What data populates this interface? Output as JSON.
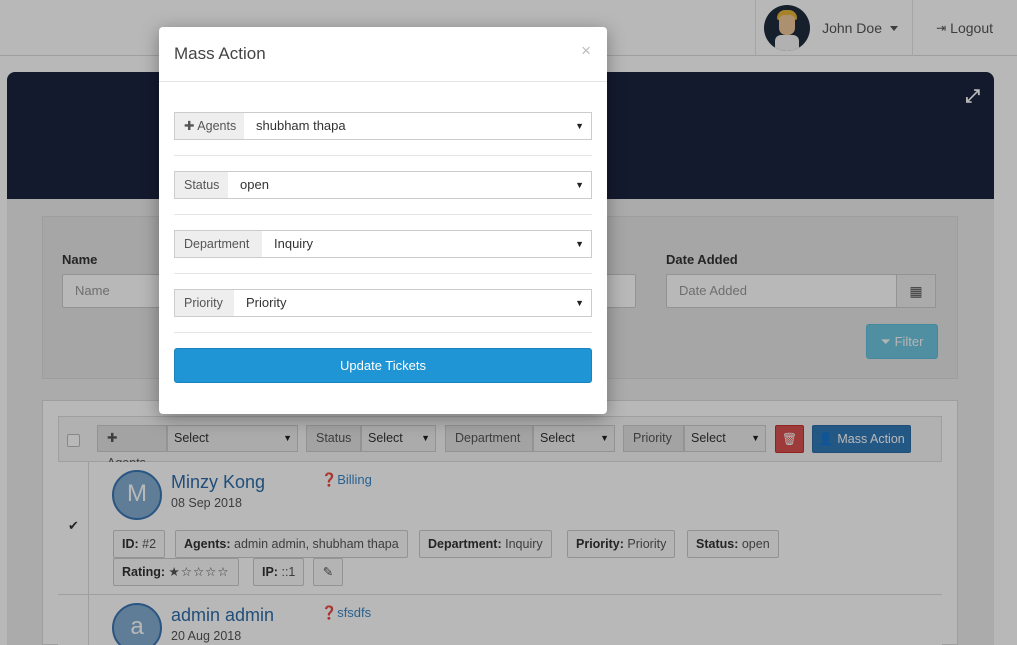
{
  "topbar": {
    "user_name": "John Doe",
    "logout_label": "Logout"
  },
  "filters": {
    "name_label": "Name",
    "name_placeholder": "Name",
    "date_label": "Date Added",
    "date_placeholder": "Date Added",
    "filter_button": "Filter"
  },
  "toolbar": {
    "agents_label": "Agents",
    "agents_value": "Select",
    "status_label": "Status",
    "status_value": "Select",
    "department_label": "Department",
    "department_value": "Select",
    "priority_label": "Priority",
    "priority_value": "Select",
    "mass_action_label": "Mass Action"
  },
  "tickets": [
    {
      "initial": "M",
      "name": "Minzy Kong",
      "date": "08 Sep 2018",
      "department": "Billing",
      "id_label": "ID:",
      "id_value": "#2",
      "agents_label": "Agents:",
      "agents_value": "admin admin, shubham thapa",
      "department_label": "Department:",
      "department_value": "Inquiry",
      "priority_label": "Priority:",
      "priority_value": "Priority",
      "status_label": "Status:",
      "status_value": "open",
      "rating_label": "Rating:",
      "rating_stars": "★☆☆☆☆",
      "ip_label": "IP:",
      "ip_value": "::1",
      "checked": true
    },
    {
      "initial": "a",
      "name": "admin admin",
      "date": "20 Aug 2018",
      "department": "sfsdfs"
    }
  ],
  "modal": {
    "title": "Mass Action",
    "close": "×",
    "agents_label": "Agents",
    "agents_value": "shubham thapa",
    "status_label": "Status",
    "status_value": "open",
    "department_label": "Department",
    "department_value": "Inquiry",
    "priority_label": "Priority",
    "priority_value": "Priority",
    "update_button": "Update Tickets"
  }
}
